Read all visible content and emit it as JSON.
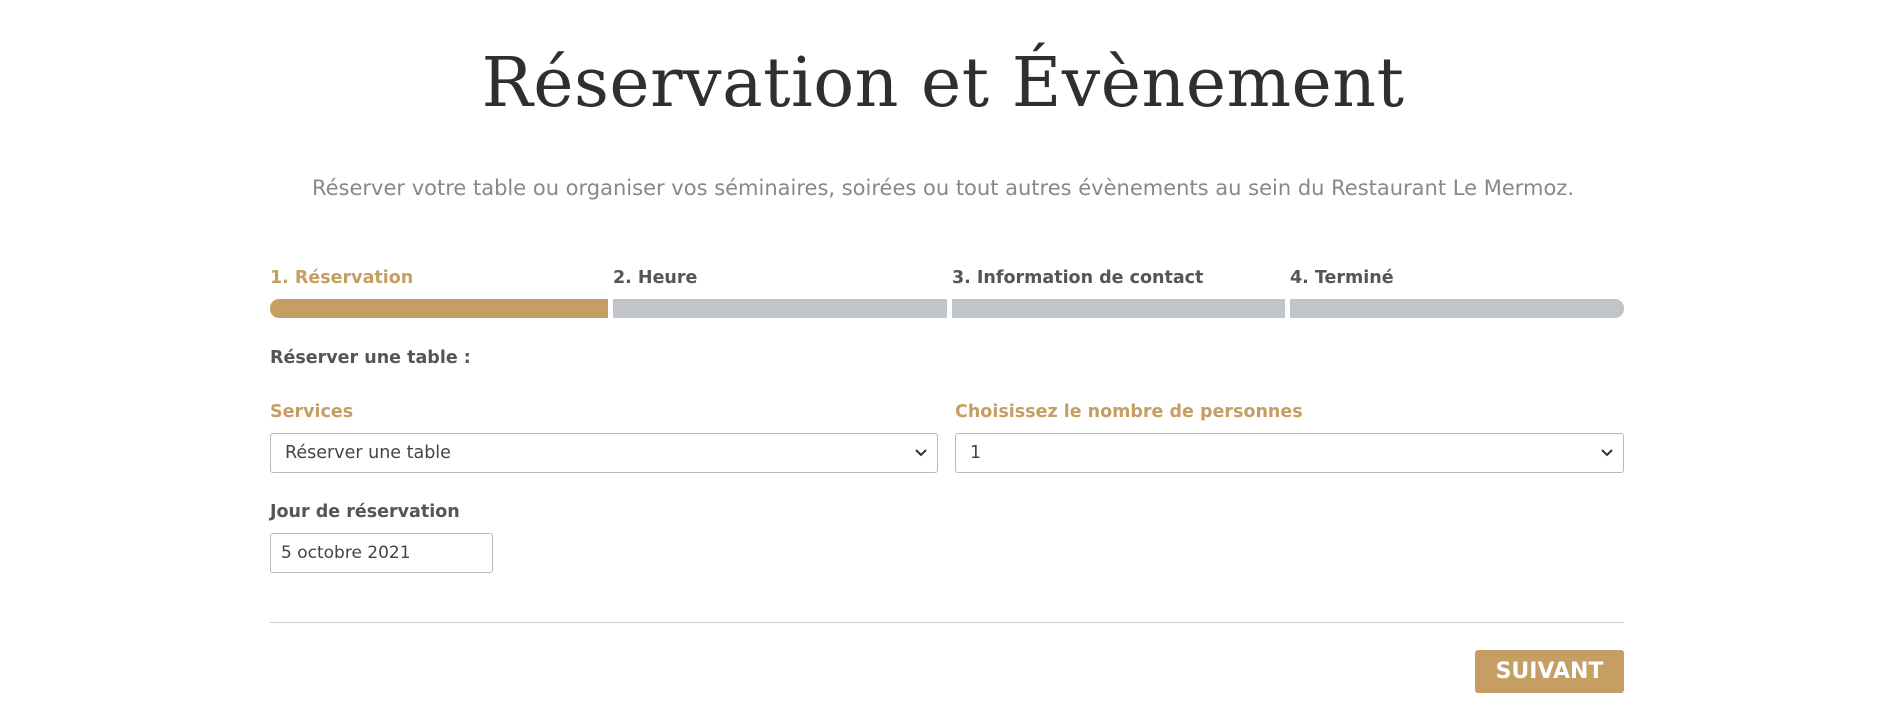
{
  "page": {
    "title": "Réservation et Évènement",
    "subtitle": "Réserver votre table ou organiser vos séminaires, soirées ou tout autres évènements au sein du Restaurant Le Mermoz."
  },
  "steps": [
    {
      "label": "1. Réservation",
      "active": true
    },
    {
      "label": "2. Heure",
      "active": false
    },
    {
      "label": "3. Information de contact",
      "active": false
    },
    {
      "label": "4. Terminé",
      "active": false
    }
  ],
  "form": {
    "section_label": "Réserver une table :",
    "services": {
      "label": "Services",
      "selected": "Réserver une table"
    },
    "persons": {
      "label": "Choisissez le nombre de personnes",
      "selected": "1"
    },
    "date": {
      "label": "Jour de réservation",
      "value": "5 octobre 2021"
    }
  },
  "actions": {
    "next_label": "SUIVANT"
  },
  "colors": {
    "accent": "#c59e63",
    "inactive_bar": "#c1c4c8",
    "title": "#2f2f2f",
    "subtitle": "#888888"
  },
  "icons": {
    "select_arrow": "chevron-down-icon"
  }
}
